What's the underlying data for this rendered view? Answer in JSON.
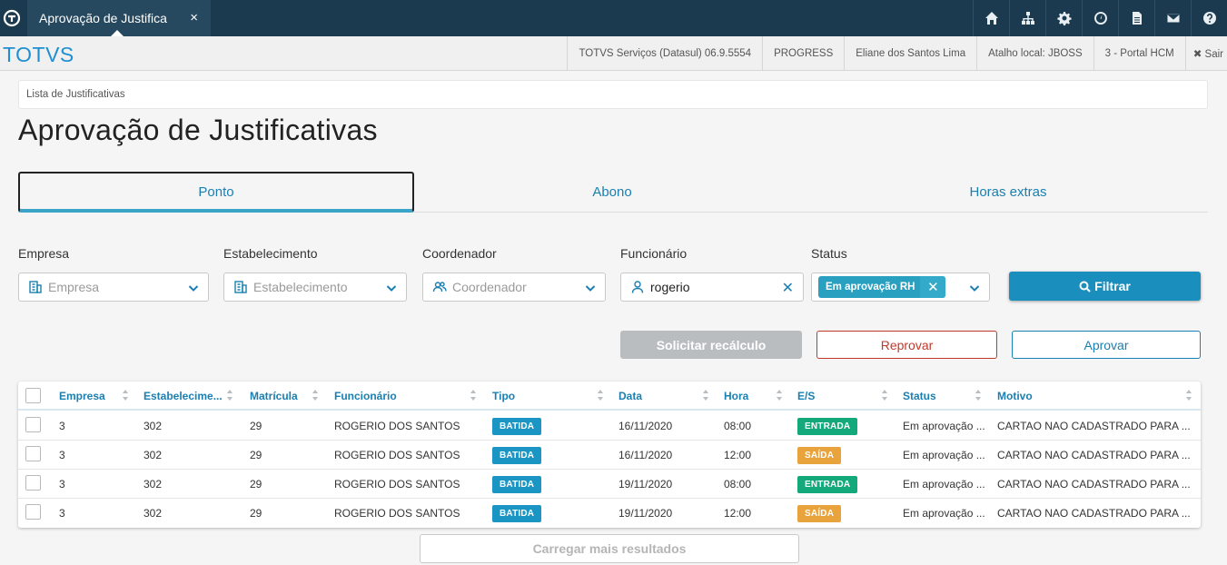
{
  "topbar": {
    "tab_title": "Aprovação de Justifica",
    "tab_close": "×",
    "icons": [
      "home-icon",
      "org-chart-icon",
      "gear-icon",
      "clock-icon",
      "document-icon",
      "mail-icon",
      "help-icon"
    ]
  },
  "subbar": {
    "brand": "TOTVS",
    "items": [
      "TOTVS Serviços (Datasul) 06.9.5554",
      "PROGRESS",
      "Eliane dos Santos Lima",
      "Atalho local: JBOSS",
      "3 - Portal HCM"
    ],
    "logout": "✖ Sair"
  },
  "breadcrumb": "Lista de Justificativas",
  "page_title": "Aprovação de Justificativas",
  "tabs": [
    "Ponto",
    "Abono",
    "Horas extras"
  ],
  "filters": {
    "empresa": {
      "label": "Empresa",
      "placeholder": "Empresa"
    },
    "estabelecimento": {
      "label": "Estabelecimento",
      "placeholder": "Estabelecimento"
    },
    "coordenador": {
      "label": "Coordenador",
      "placeholder": "Coordenador"
    },
    "funcionario": {
      "label": "Funcionário",
      "value": "rogerio"
    },
    "status": {
      "label": "Status",
      "chip": "Em aprovação RH"
    }
  },
  "actions": {
    "filter": "Filtrar",
    "recalc": "Solicitar recálculo",
    "reprove": "Reprovar",
    "approve": "Aprovar",
    "load_more": "Carregar mais resultados"
  },
  "table": {
    "columns": [
      "Empresa",
      "Estabelecime...",
      "Matrícula",
      "Funcionário",
      "Tipo",
      "Data",
      "Hora",
      "E/S",
      "Status",
      "Motivo"
    ],
    "rows": [
      {
        "empresa": "3",
        "estab": "302",
        "matricula": "29",
        "funcionario": "ROGERIO DOS SANTOS",
        "tipo": "BATIDA",
        "data": "16/11/2020",
        "hora": "08:00",
        "es": "ENTRADA",
        "status": "Em aprovação ...",
        "motivo": "CARTAO NAO CADASTRADO PARA ..."
      },
      {
        "empresa": "3",
        "estab": "302",
        "matricula": "29",
        "funcionario": "ROGERIO DOS SANTOS",
        "tipo": "BATIDA",
        "data": "16/11/2020",
        "hora": "12:00",
        "es": "SAÍDA",
        "status": "Em aprovação ...",
        "motivo": "CARTAO NAO CADASTRADO PARA ..."
      },
      {
        "empresa": "3",
        "estab": "302",
        "matricula": "29",
        "funcionario": "ROGERIO DOS SANTOS",
        "tipo": "BATIDA",
        "data": "19/11/2020",
        "hora": "08:00",
        "es": "ENTRADA",
        "status": "Em aprovação ...",
        "motivo": "CARTAO NAO CADASTRADO PARA ..."
      },
      {
        "empresa": "3",
        "estab": "302",
        "matricula": "29",
        "funcionario": "ROGERIO DOS SANTOS",
        "tipo": "BATIDA",
        "data": "19/11/2020",
        "hora": "12:00",
        "es": "SAÍDA",
        "status": "Em aprovação ...",
        "motivo": "CARTAO NAO CADASTRADO PARA ..."
      }
    ]
  },
  "colors": {
    "topbar": "#1b3a4f",
    "accent": "#1a7fb1",
    "entrada": "#14a97a",
    "saida": "#e8a33d",
    "reprove": "#c0392b"
  }
}
